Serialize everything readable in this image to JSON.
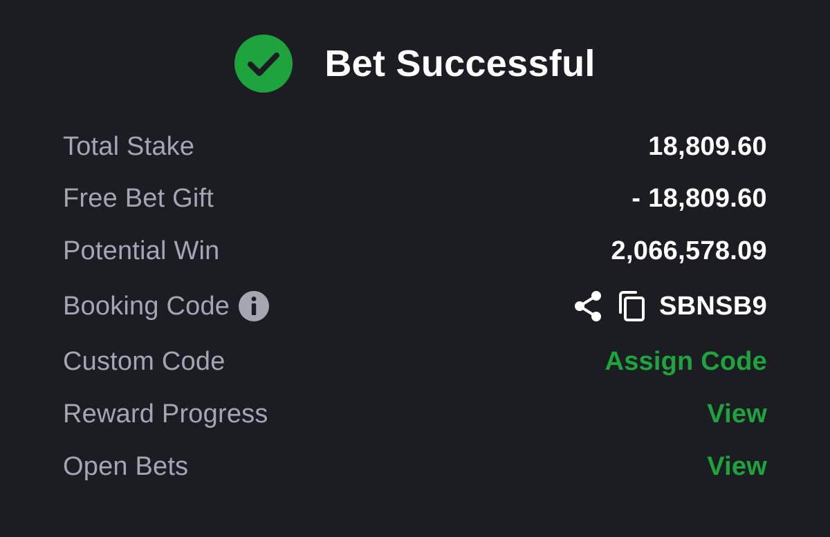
{
  "header": {
    "title": "Bet Successful",
    "icon": "check-circle-icon",
    "accent_color": "#1fa33c"
  },
  "rows": {
    "total_stake": {
      "label": "Total Stake",
      "value": "18,809.60"
    },
    "free_bet_gift": {
      "label": "Free Bet Gift",
      "value": "- 18,809.60"
    },
    "potential_win": {
      "label": "Potential Win",
      "value": "2,066,578.09"
    },
    "booking_code": {
      "label": "Booking Code",
      "info_icon": "info-icon",
      "share_icon": "share-icon",
      "copy_icon": "copy-icon",
      "value": "SBNSB9"
    },
    "custom_code": {
      "label": "Custom Code",
      "action": "Assign Code"
    },
    "reward_progress": {
      "label": "Reward Progress",
      "action": "View"
    },
    "open_bets": {
      "label": "Open Bets",
      "action": "View"
    }
  },
  "colors": {
    "background": "#1c1d23",
    "label": "#a4a7b3",
    "value": "#ffffff",
    "link": "#1fa33c"
  }
}
